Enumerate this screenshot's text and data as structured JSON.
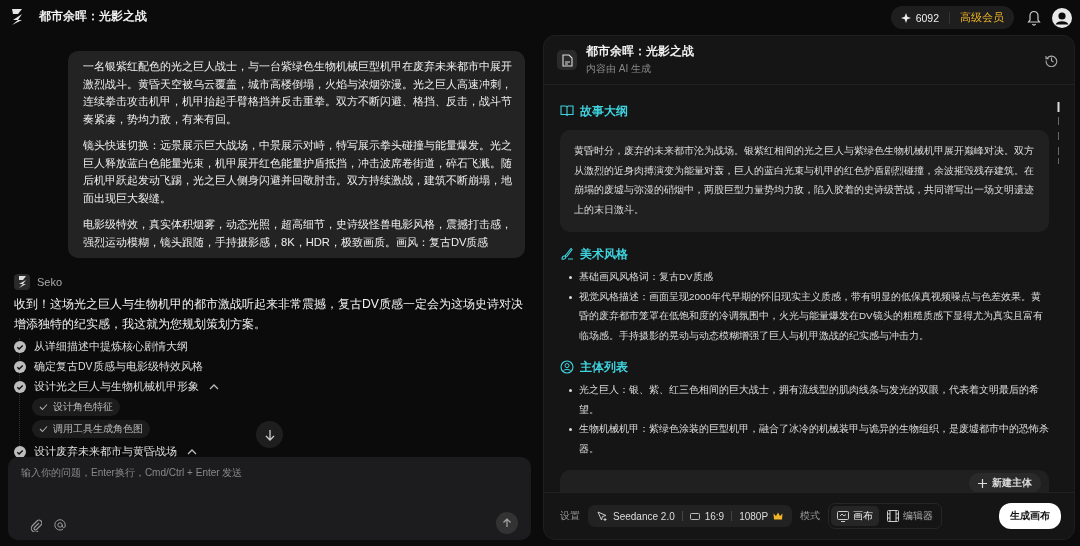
{
  "header": {
    "title": "都市余晖：光影之战",
    "credits": "6092",
    "membership": "高级会员"
  },
  "chat": {
    "user_message": [
      "一名银紫红配色的光之巨人战士，与一台紫绿色生物机械巨型机甲在废弃未来都市中展开激烈战斗。黄昏天空被乌云覆盖，城市高楼倒塌，火焰与浓烟弥漫。光之巨人高速冲刺，连续拳击攻击机甲，机甲抬起手臂格挡并反击重拳。双方不断闪避、格挡、反击，战斗节奏紧凑，势均力敌，有来有回。",
      "镜头快速切换：远景展示巨大战场，中景展示对峙，特写展示拳头碰撞与能量爆发。光之巨人释放蓝白色能量光束，机甲展开红色能量护盾抵挡，冲击波席卷街道，碎石飞溅。随后机甲跃起发动飞踢，光之巨人侧身闪避并回敬肘击。双方持续激战，建筑不断崩塌，地面出现巨大裂缝。",
      "电影级特效，真实体积烟雾，动态光照，超高细节，史诗级怪兽电影风格，震撼打击感，强烈运动模糊，镜头跟随，手持摄影感，8K，HDR，极致画质。画风：复古DV质感"
    ],
    "assistant_name": "Seko",
    "reply": "收到！这场光之巨人与生物机甲的都市激战听起来非常震撼，复古DV质感一定会为这场史诗对决增添独特的纪实感，我这就为您规划策划方案。",
    "steps": [
      {
        "label": "从详细描述中提炼核心剧情大纲",
        "done": true
      },
      {
        "label": "确定复古DV质感与电影级特效风格",
        "done": true
      },
      {
        "label": "设计光之巨人与生物机械机甲形象",
        "done": true,
        "expanded": true,
        "children": [
          {
            "label": "设计角色特征",
            "done": true
          },
          {
            "label": "调用工具生成角色图",
            "done": true
          }
        ]
      },
      {
        "label": "设计废弃未来都市与黄昏战场",
        "done": true,
        "expanded": true
      }
    ],
    "input": {
      "placeholder": "输入你的问题，Enter换行，Cmd/Ctrl + Enter 发送"
    }
  },
  "doc": {
    "title": "都市余晖：光影之战",
    "subtitle": "内容由 AI 生成",
    "sections": [
      {
        "kind": "paragraph",
        "title": "故事大纲",
        "text": "黄昏时分，废弃的未来都市沦为战场。银紫红相间的光之巨人与紫绿色生物机械机甲展开巅峰对决。双方从激烈的近身肉搏演变为能量对轰，巨人的蓝白光束与机甲的红色护盾剧烈碰撞，余波摧毁残存建筑。在崩塌的废墟与弥漫的硝烟中，两股巨型力量势均力敌，陷入胶着的史诗级苦战，共同谱写出一场文明遗迹上的末日激斗。"
      },
      {
        "kind": "bullets",
        "title": "美术风格",
        "items": [
          "基础画风风格词：复古DV质感",
          "视觉风格描述：画面呈现2000年代早期的怀旧现实主义质感，带有明显的低保真视频噪点与色差效果。黄昏的废弃都市笼罩在低饱和度的冷调氛围中，火光与能量爆发在DV镜头的粗糙质感下显得尤为真实且富有临场感。手持摄影的晃动与动态模糊增强了巨人与机甲激战的纪实感与冲击力。"
        ]
      },
      {
        "kind": "bullets",
        "title": "主体列表",
        "items": [
          "光之巨人：银、紫、红三色相间的巨大战士，拥有流线型的肌肉线条与发光的双眼，代表着文明最后的希望。",
          "生物机械机甲：紫绿色涂装的巨型机甲，融合了冰冷的机械装甲与诡异的生物组织，是废墟都市中的恐怖杀器。"
        ]
      }
    ],
    "new_subject_button": "新建主体"
  },
  "footer": {
    "settings_label": "设置",
    "model": "Seedance 2.0",
    "ratio": "16:9",
    "resolution": "1080P",
    "mode_label": "模式",
    "modes": [
      {
        "label": "画布",
        "selected": true
      },
      {
        "label": "编辑器",
        "selected": false
      }
    ],
    "generate_button": "生成画布"
  }
}
